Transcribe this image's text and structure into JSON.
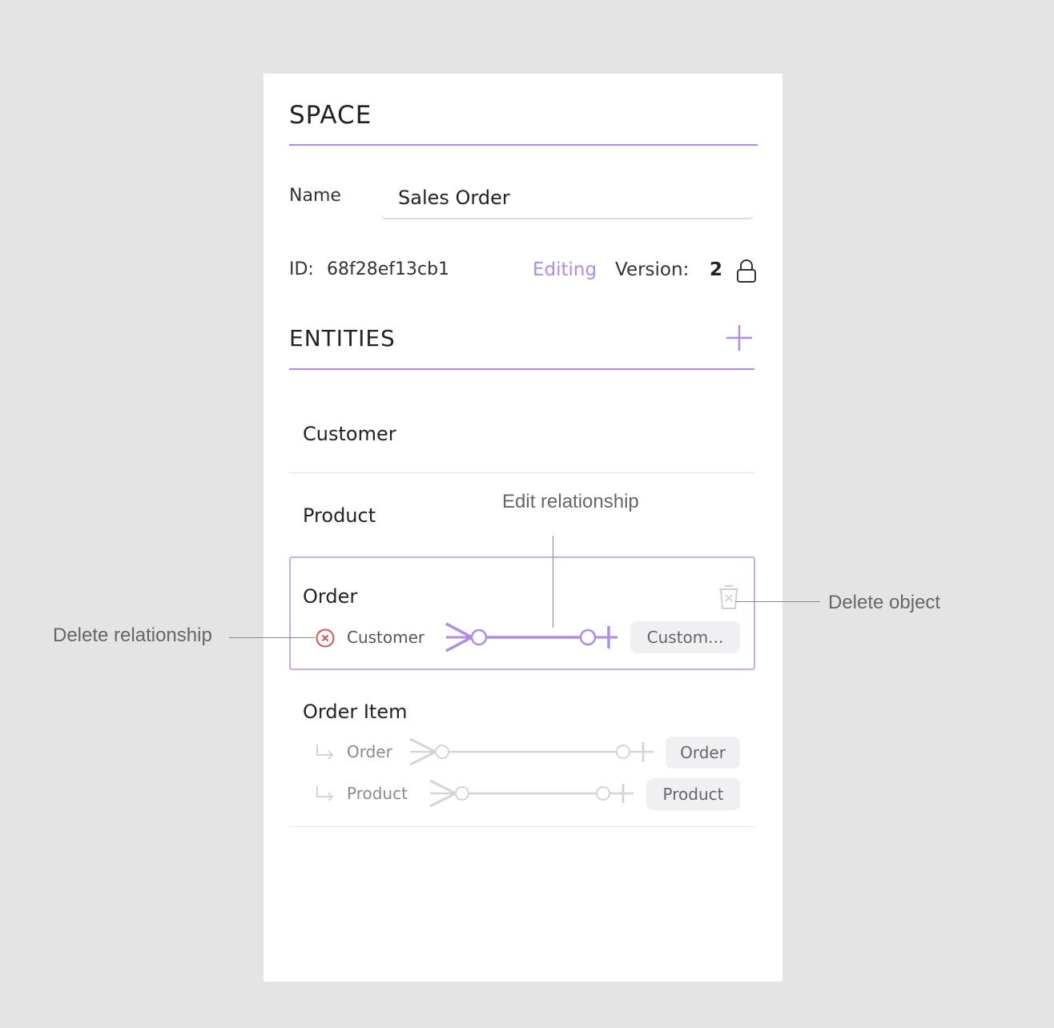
{
  "space": {
    "title": "SPACE",
    "name_label": "Name",
    "name_value": "Sales Order",
    "id_label": "ID:",
    "id_value": "68f28ef13cb1",
    "status": "Editing",
    "version_label": "Version:",
    "version_value": "2"
  },
  "entities": {
    "title": "ENTITIES",
    "items": [
      {
        "name": "Customer"
      },
      {
        "name": "Product"
      },
      {
        "name": "Order",
        "relationships": [
          {
            "label": "Customer",
            "target": "Custom..."
          }
        ]
      },
      {
        "name": "Order Item",
        "relationships": [
          {
            "label": "Order",
            "target": "Order"
          },
          {
            "label": "Product",
            "target": "Product"
          }
        ]
      }
    ]
  },
  "annotations": {
    "edit_relationship": "Edit relationship",
    "delete_object": "Delete object",
    "delete_relationship": "Delete relationship"
  },
  "colors": {
    "accent": "#b18bea",
    "delete": "#d9534f",
    "background": "#e4e4e4"
  }
}
